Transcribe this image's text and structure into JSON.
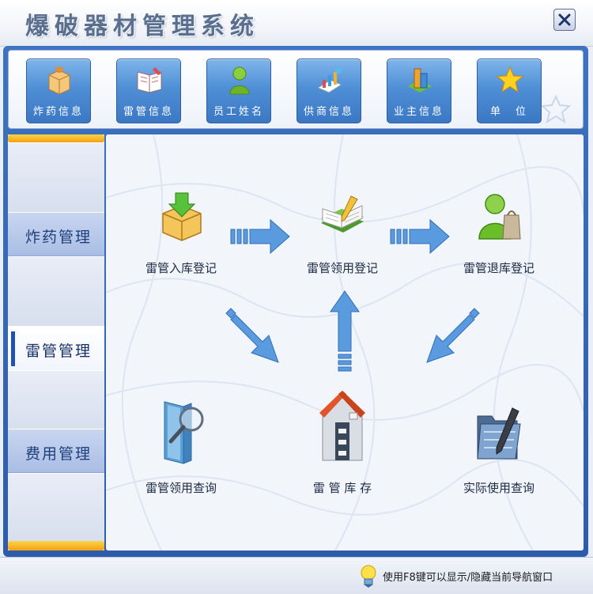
{
  "window": {
    "title": "爆破器材管理系统",
    "close_label": "close"
  },
  "toolbar": {
    "buttons": [
      {
        "label": "炸药信息",
        "icon": "explosive-box-icon"
      },
      {
        "label": "雷管信息",
        "icon": "book-icon"
      },
      {
        "label": "员工姓名",
        "icon": "person-icon"
      },
      {
        "label": "供商信息",
        "icon": "chart-icon"
      },
      {
        "label": "业主信息",
        "icon": "building-icon"
      },
      {
        "label": "单　位",
        "icon": "star-icon"
      }
    ]
  },
  "sidebar": {
    "items": [
      {
        "label": "炸药管理",
        "active": false
      },
      {
        "label": "雷管管理",
        "active": true
      },
      {
        "label": "费用管理",
        "active": false
      }
    ]
  },
  "content": {
    "nodes": [
      {
        "label": "雷管入库登记",
        "icon": "download-box-icon"
      },
      {
        "label": "雷管领用登记",
        "icon": "book-pencil-icon"
      },
      {
        "label": "雷管退库登记",
        "icon": "person-bag-icon"
      },
      {
        "label": "雷管领用查询",
        "icon": "magnifier-icon"
      },
      {
        "label": "雷 管 库 存",
        "icon": "warehouse-icon"
      },
      {
        "label": "实际使用查询",
        "icon": "folder-pen-icon"
      }
    ]
  },
  "statusbar": {
    "tip": "使用F8键可以显示/隐藏当前导航窗口",
    "icon": "lightbulb-icon"
  },
  "colors": {
    "frame": "#3a6fc0",
    "accent": "#f4a012",
    "arrow": "#5a9be0"
  }
}
